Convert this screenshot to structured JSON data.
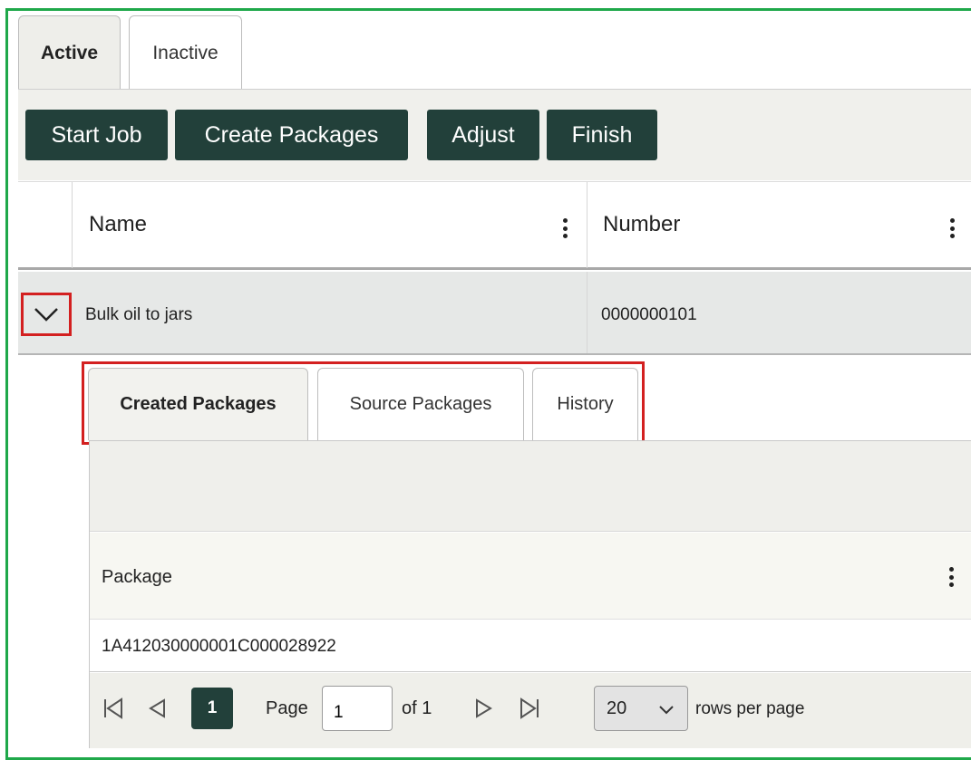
{
  "outer_tabs": [
    {
      "label": "Active",
      "active": true
    },
    {
      "label": "Inactive",
      "active": false
    }
  ],
  "toolbar": {
    "start_job": "Start Job",
    "create_packages": "Create Packages",
    "adjust": "Adjust",
    "finish": "Finish"
  },
  "grid": {
    "columns": [
      "Name",
      "Number"
    ],
    "rows": [
      {
        "name": "Bulk oil to jars",
        "number": "0000000101",
        "expanded": true
      }
    ]
  },
  "detail": {
    "tabs": [
      {
        "label": "Created Packages",
        "active": true
      },
      {
        "label": "Source Packages",
        "active": false
      },
      {
        "label": "History",
        "active": false
      }
    ],
    "column": "Package",
    "rows": [
      "1A412030000001C000028922"
    ]
  },
  "pager": {
    "current_page": "1",
    "page_label": "Page",
    "page_input": "1",
    "of_label": "of 1",
    "rows_per_page_value": "20",
    "rows_per_page_label": "rows per page"
  },
  "colors": {
    "frame_green": "#1fa84a",
    "highlight_red": "#d32020",
    "button_dark": "#22403a"
  },
  "icons": [
    "chevron-down-icon",
    "kebab-menu-icon",
    "first-page-icon",
    "prev-page-icon",
    "next-page-icon",
    "last-page-icon"
  ]
}
